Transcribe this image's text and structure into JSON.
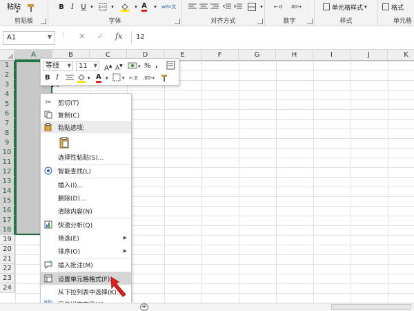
{
  "ribbon": {
    "clipboard": {
      "paste_label": "粘贴",
      "group_label": "剪贴板"
    },
    "font": {
      "bold": "B",
      "italic": "I",
      "underline": "U",
      "color_a": "A",
      "phonetic": "wén文",
      "group_label": "字体"
    },
    "alignment": {
      "group_label": "对齐方式"
    },
    "number": {
      "group_label": "数字"
    },
    "styles": {
      "cell_style": "单元格样式",
      "group_label": "样式"
    },
    "cells": {
      "format_label": "格式",
      "group_label": "单元格"
    }
  },
  "formula_bar": {
    "name_box": "A1",
    "cancel": "✕",
    "enter": "✓",
    "fx": "fx",
    "value": "12"
  },
  "columns": [
    "A",
    "B",
    "C",
    "D",
    "E",
    "F",
    "G",
    "H",
    "I",
    "J",
    "K"
  ],
  "rows": [
    "1",
    "2",
    "3",
    "4",
    "5",
    "6",
    "7",
    "8",
    "9",
    "10",
    "11",
    "12",
    "13",
    "14",
    "15",
    "16",
    "17",
    "18",
    "19",
    "20",
    "21",
    "22",
    "23",
    "24"
  ],
  "partial_cells": {
    "b3": "14"
  },
  "mini_toolbar": {
    "font_name": "等线",
    "font_size": "11",
    "grow": "A",
    "shrink": "A",
    "percent": "%",
    "comma": ",",
    "bold": "B",
    "italic": "I",
    "font_color": "A"
  },
  "context_menu": {
    "items": [
      {
        "label": "剪切(T)",
        "icon": "scissors-icon"
      },
      {
        "label": "复制(C)",
        "icon": "copy-icon"
      },
      {
        "label": "粘贴选项:",
        "icon": "paste-icon"
      },
      {
        "label": "选择性粘贴(S)...",
        "icon": ""
      },
      {
        "label": "智能查找(L)",
        "icon": "smart-lookup-icon"
      },
      {
        "label": "插入(I)...",
        "icon": ""
      },
      {
        "label": "删除(D)...",
        "icon": ""
      },
      {
        "label": "清除内容(N)",
        "icon": ""
      },
      {
        "label": "快速分析(Q)",
        "icon": "quick-analysis-icon"
      },
      {
        "label": "筛选(E)",
        "icon": "",
        "submenu": true
      },
      {
        "label": "排序(O)",
        "icon": "",
        "submenu": true
      },
      {
        "label": "插入批注(M)",
        "icon": "comment-icon"
      },
      {
        "label": "设置单元格格式(F)...",
        "icon": "format-cells-icon",
        "highlighted": true
      },
      {
        "label": "从下拉列表中选择(K)...",
        "icon": ""
      },
      {
        "label": "显示拼音字段(S)",
        "icon": "phonetic-icon"
      }
    ]
  },
  "colors": {
    "accent_green": "#217346",
    "selection_gray": "#c8c8c8",
    "highlight": "#d6d6d6",
    "pointer_red": "#e02020"
  }
}
